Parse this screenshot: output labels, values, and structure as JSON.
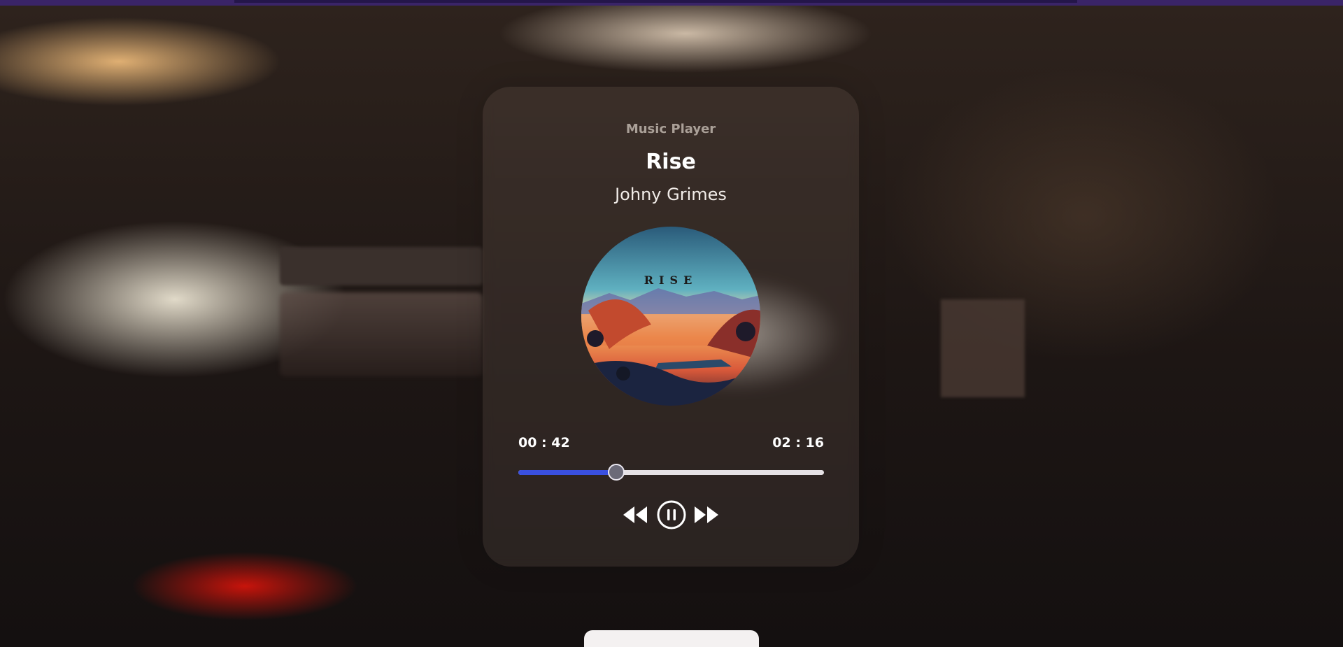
{
  "player": {
    "label": "Music Player",
    "song_title": "Rise",
    "artist": "Johny Grimes",
    "cover_text": "RISE",
    "current_time": "00 : 42",
    "total_time": "02 : 16",
    "progress_fraction": 0.32,
    "state": "playing"
  },
  "controls": {
    "prev_icon": "rewind-icon",
    "play_pause_icon": "pause-circle-icon",
    "next_icon": "fast-forward-icon"
  },
  "colors": {
    "progress_fill": "#3a50e0",
    "progress_track": "#e6e2e6",
    "text": "#ffffff"
  }
}
